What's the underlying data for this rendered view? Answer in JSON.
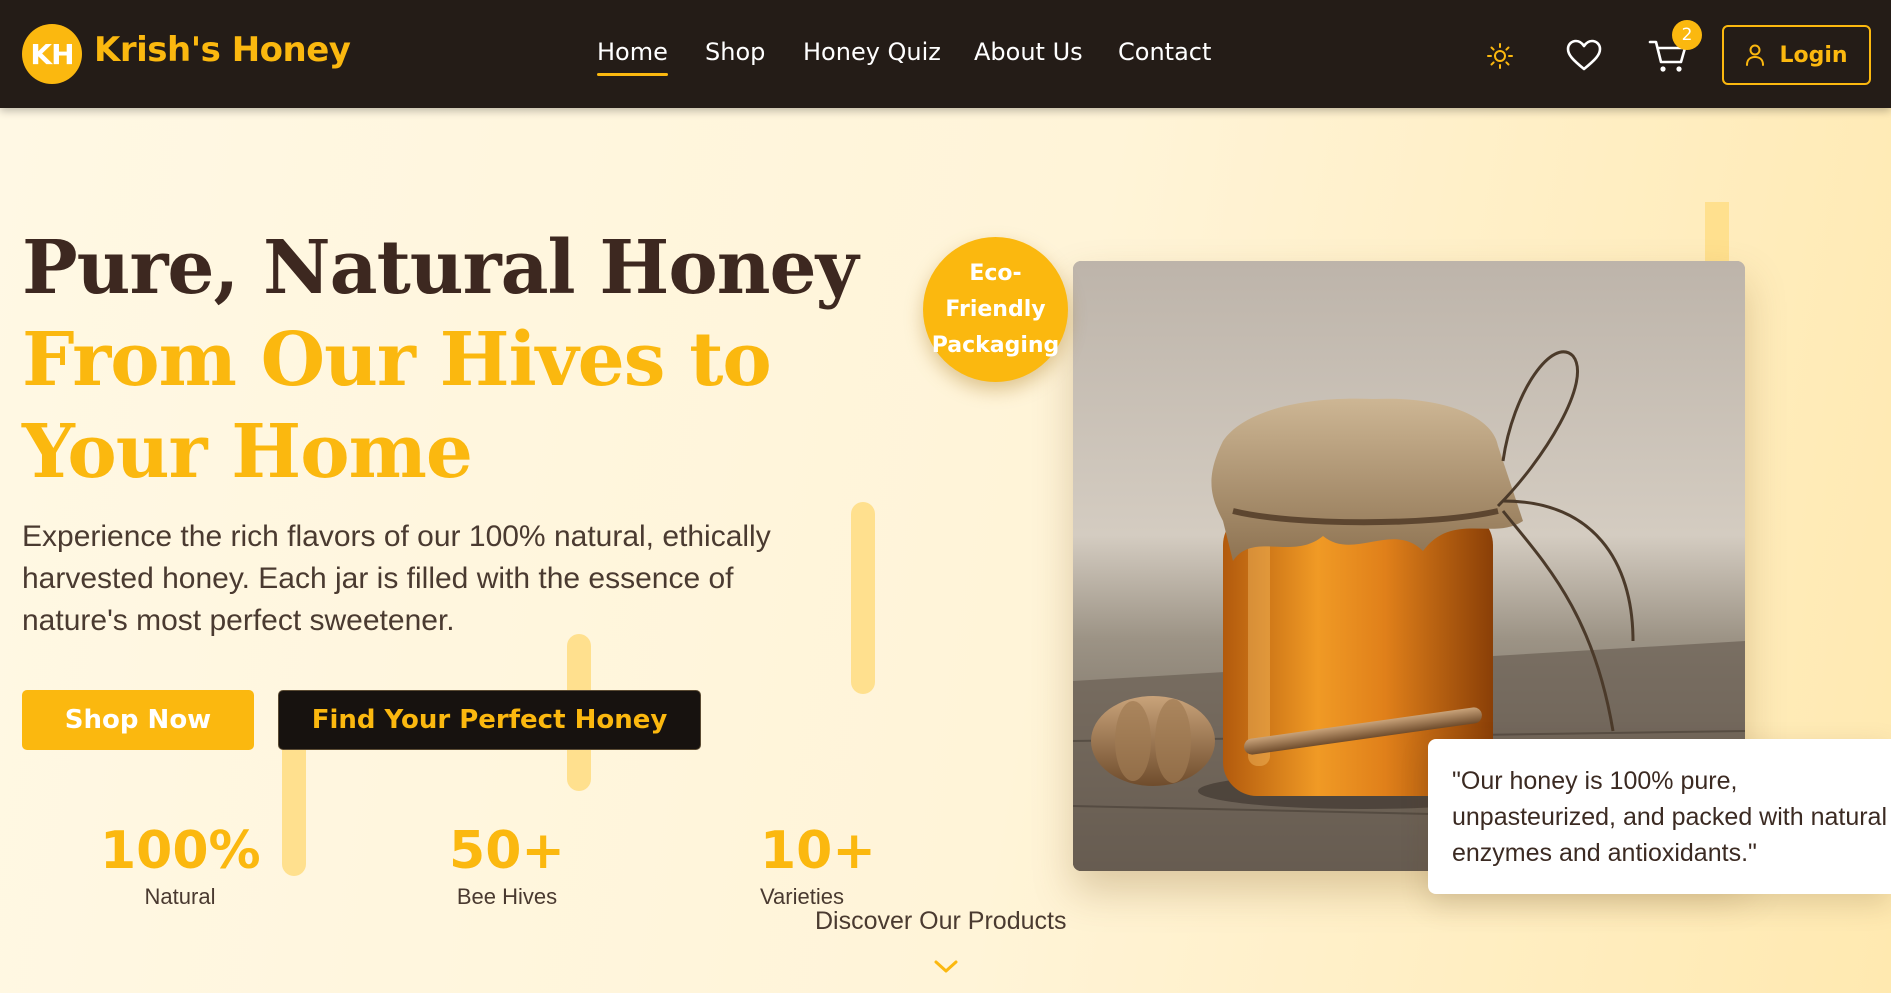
{
  "brand": {
    "initials": "KH",
    "name": "Krish's Honey"
  },
  "nav": {
    "links": [
      {
        "label": "Home",
        "active": true
      },
      {
        "label": "Shop",
        "active": false
      },
      {
        "label": "Honey Quiz",
        "active": false
      },
      {
        "label": "About Us",
        "active": false
      },
      {
        "label": "Contact",
        "active": false
      }
    ],
    "icons": [
      "sun-icon",
      "heart-icon",
      "cart-icon"
    ],
    "cart_count": "2",
    "login_label": "Login"
  },
  "hero": {
    "title_line1": "Pure, Natural Honey",
    "title_line2": "From Our Hives to Your Home",
    "description": "Experience the rich flavors of our 100% natural, ethically harvested honey. Each jar is filled with the essence of nature's most perfect sweetener.",
    "primary_button": "Shop Now",
    "secondary_button": "Find Your Perfect Honey"
  },
  "stats": [
    {
      "value": "100%",
      "label": "Natural"
    },
    {
      "value": "50+",
      "label": "Bee Hives"
    },
    {
      "value": "10+",
      "label": "Varieties"
    }
  ],
  "discover": {
    "label": "Discover Our Products"
  },
  "badge": {
    "text": "Eco-Friendly Packaging"
  },
  "quote": {
    "text": "\"Our honey is 100% pure, unpasteurized, and packed with natural enzymes and antioxidants.\""
  },
  "colors": {
    "accent": "#fbb80f",
    "nav_bg": "#241c17",
    "title_dark": "#3d2820"
  }
}
